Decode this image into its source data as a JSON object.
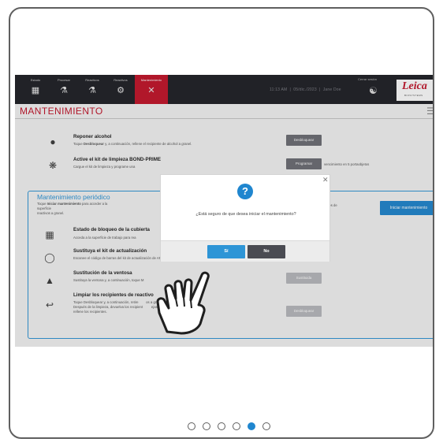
{
  "nav": [
    {
      "label": "Estado",
      "icon": "status-icon",
      "glyph": "▦"
    },
    {
      "label": "Procesar",
      "icon": "process-icon",
      "glyph": "⚗"
    },
    {
      "label": "Reactivos",
      "icon": "reagents-icon",
      "glyph": "⚗"
    },
    {
      "label": "Reactivos",
      "icon": "reagents-config-icon",
      "glyph": "⚙"
    },
    {
      "label": "Mantenimiento",
      "icon": "tools-icon",
      "glyph": "✕"
    }
  ],
  "status": {
    "time": "11:13 AM",
    "date": "05/dic./2023",
    "user": "Jane Doe",
    "logout": "Cerrar sesión"
  },
  "logo": {
    "word": "Leica",
    "sub": "BIOSYSTEMS"
  },
  "page_title": "MANTENIMIENTO",
  "top_items": [
    {
      "title": "Reponer alcohol",
      "desc_bold": "Desbloquear",
      "desc_pre": "Toque ",
      "desc_post": " y, a continuación, rellene el recipiente de alcohol a granel.",
      "button": "Desbloquear"
    },
    {
      "title": "Active el kit de limpieza BOND-PRIME",
      "desc": "Cargue el kit de limpieza y programe una",
      "button": "Programar",
      "note": "vencimiento en 5 portaobjetos"
    }
  ],
  "periodic": {
    "title": "Mantenimiento periódico",
    "desc_pre": "Toque ",
    "desc_bold": "Iniciar mantenimiento",
    "desc_post": " para acceder a la superficie",
    "desc_line2": "reactivos a granel.",
    "desc_right": "ecipientes de",
    "button": "Iniciar mantenimiento",
    "items": [
      {
        "title": "Estado de bloqueo de la cubierta",
        "desc": "Acceda a la superficie de trabajo para rea"
      },
      {
        "title": "Sustituya el kit de actualización",
        "desc": "Escanee el código de barras del kit de actualización de ARC."
      },
      {
        "title": "Sustitución de la ventosa",
        "desc": "Sustituya la ventosa y, a continuación, toque M",
        "button": "Sustituida"
      },
      {
        "title": "Limpiar los recipientes de reactivo",
        "desc1": "Toque Desbloquear y, a continuación, retire",
        "desc1b": "os a granel.",
        "desc2": "Después de la limpieza, devuelva los recipient",
        "desc2b": "ejas. Escanee y",
        "desc3": "rellene los recipientes.",
        "button": "Desbloquear"
      }
    ]
  },
  "dialog": {
    "icon": "question-icon",
    "question_glyph": "?",
    "message": "¿Está seguro de que desea iniciar el mantenimiento?",
    "yes": "Sí",
    "no": "No",
    "close_glyph": "✕"
  },
  "colors": {
    "accent": "#c3142a",
    "blue": "#1f86cf",
    "dark": "#1f2026"
  },
  "pagination": {
    "count": 6,
    "active": 5
  }
}
